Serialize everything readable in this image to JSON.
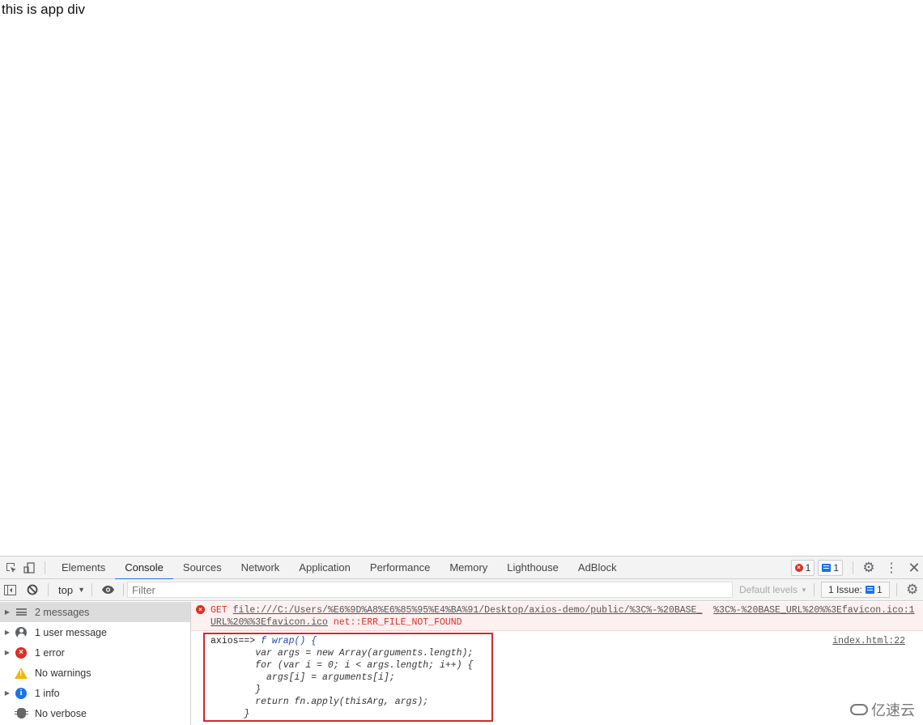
{
  "page": {
    "text": "this is app div"
  },
  "devtools": {
    "tabs": [
      {
        "label": "Elements"
      },
      {
        "label": "Console",
        "active": true
      },
      {
        "label": "Sources"
      },
      {
        "label": "Network"
      },
      {
        "label": "Application"
      },
      {
        "label": "Performance"
      },
      {
        "label": "Memory"
      },
      {
        "label": "Lighthouse"
      },
      {
        "label": "AdBlock"
      }
    ],
    "badges": {
      "errors": "1",
      "messages": "1"
    },
    "toolbar": {
      "context": "top",
      "filter_placeholder": "Filter",
      "levels": "Default levels",
      "issues_label": "1 Issue:",
      "issues_count": "1"
    },
    "sidebar": {
      "items": [
        {
          "label": "2 messages",
          "icon": "list-icon",
          "expandable": true,
          "selected": true
        },
        {
          "label": "1 user message",
          "icon": "user-icon",
          "expandable": true
        },
        {
          "label": "1 error",
          "icon": "error-icon",
          "expandable": true
        },
        {
          "label": "No warnings",
          "icon": "warning-icon",
          "expandable": false
        },
        {
          "label": "1 info",
          "icon": "info-icon",
          "expandable": true
        },
        {
          "label": "No verbose",
          "icon": "bug-icon",
          "expandable": false
        }
      ]
    },
    "console": {
      "error": {
        "method": "GET",
        "url_part1": "file:///C:/Users/%E6%9D%A8%E6%85%95%E4%BA%91/Desktop/axios-demo/public/%3C%-%20BASE_",
        "url_part2": "%3C%-%20BASE_URL%20%%3Efavicon.ico:1",
        "url_part3": "URL%20%%3Efavicon.ico",
        "message": "net::ERR_FILE_NOT_FOUND"
      },
      "log": {
        "prefix": "axios==> ",
        "lines": [
          "f wrap() {",
          "        var args = new Array(arguments.length);",
          "        for (var i = 0; i < args.length; i++) {",
          "          args[i] = arguments[i];",
          "        }",
          "        return fn.apply(thisArg, args);",
          "      }"
        ],
        "source": "index.html:22"
      }
    },
    "colors": {
      "accent": "#1a73e8",
      "error": "#d93025",
      "highlight_box": "#d6272d"
    }
  },
  "watermark": {
    "text": "亿速云"
  }
}
